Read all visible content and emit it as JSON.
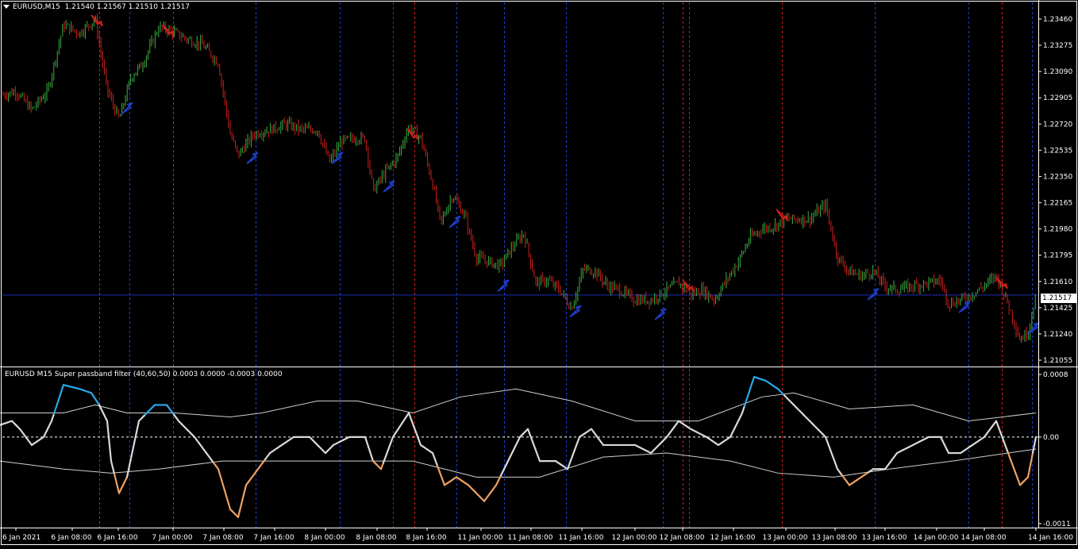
{
  "header": {
    "symbol": "EURUSD,M15",
    "ohlc": "1.21540 1.21567 1.21510 1.21517"
  },
  "indicator": {
    "title": "EURUSD M15 Super passband filter (40,60,50) 0.0003 0.0000 -0.0003 0.0000"
  },
  "current_price": "1.21517",
  "colors": {
    "background": "#000000",
    "bull_candle": "#3cb043",
    "bear_candle": "#d0211c",
    "red_vline": "#d0211c",
    "blue_vline": "#1f3fd0",
    "up_arrow": "#1f3fd0",
    "down_arrow": "#d0211c",
    "filter_up": "#2aa8e8",
    "filter_down": "#f0a060",
    "filter_neutral": "#d8d8d8",
    "band": "#cfcfcf",
    "price_line": "#1f2fb0"
  },
  "chart_data": [
    {
      "type": "candlestick",
      "title": "EURUSD,M15",
      "y_ticks": [
        "1.23460",
        "1.23275",
        "1.23090",
        "1.22905",
        "1.22720",
        "1.22535",
        "1.22350",
        "1.22165",
        "1.21980",
        "1.21795",
        "1.21610",
        "1.21425",
        "1.21240",
        "1.21055"
      ],
      "ylim": [
        1.21055,
        1.2346
      ],
      "x_ticks": [
        "6 Jan 2021",
        "6 Jan 08:00",
        "6 Jan 16:00",
        "7 Jan 00:00",
        "7 Jan 08:00",
        "7 Jan 16:00",
        "8 Jan 00:00",
        "8 Jan 08:00",
        "8 Jan 16:00",
        "11 Jan 00:00",
        "11 Jan 08:00",
        "11 Jan 16:00",
        "12 Jan 00:00",
        "12 Jan 08:00",
        "12 Jan 16:00",
        "13 Jan 00:00",
        "13 Jan 08:00",
        "13 Jan 16:00",
        "14 Jan 00:00",
        "14 Jan 08:00",
        "14 Jan 16:00"
      ],
      "price_path": [
        [
          0,
          1.2292
        ],
        [
          20,
          1.2295
        ],
        [
          40,
          1.2282
        ],
        [
          60,
          1.2295
        ],
        [
          80,
          1.2342
        ],
        [
          100,
          1.2336
        ],
        [
          120,
          1.2346
        ],
        [
          135,
          1.2296
        ],
        [
          150,
          1.2275
        ],
        [
          165,
          1.2305
        ],
        [
          180,
          1.2315
        ],
        [
          200,
          1.234
        ],
        [
          215,
          1.2338
        ],
        [
          235,
          1.2332
        ],
        [
          255,
          1.2328
        ],
        [
          275,
          1.2315
        ],
        [
          290,
          1.2265
        ],
        [
          300,
          1.225
        ],
        [
          320,
          1.2265
        ],
        [
          340,
          1.2268
        ],
        [
          360,
          1.2272
        ],
        [
          380,
          1.2268
        ],
        [
          400,
          1.2268
        ],
        [
          415,
          1.2245
        ],
        [
          430,
          1.226
        ],
        [
          450,
          1.2262
        ],
        [
          460,
          1.2262
        ],
        [
          470,
          1.2225
        ],
        [
          485,
          1.2238
        ],
        [
          500,
          1.2248
        ],
        [
          515,
          1.227
        ],
        [
          530,
          1.2262
        ],
        [
          545,
          1.223
        ],
        [
          555,
          1.2202
        ],
        [
          570,
          1.2222
        ],
        [
          585,
          1.2208
        ],
        [
          600,
          1.2178
        ],
        [
          615,
          1.2175
        ],
        [
          630,
          1.2172
        ],
        [
          645,
          1.2185
        ],
        [
          660,
          1.2195
        ],
        [
          675,
          1.216
        ],
        [
          690,
          1.2162
        ],
        [
          705,
          1.2155
        ],
        [
          720,
          1.2142
        ],
        [
          735,
          1.217
        ],
        [
          750,
          1.2168
        ],
        [
          765,
          1.2158
        ],
        [
          780,
          1.2155
        ],
        [
          800,
          1.2148
        ],
        [
          820,
          1.2148
        ],
        [
          840,
          1.2155
        ],
        [
          855,
          1.216
        ],
        [
          870,
          1.2152
        ],
        [
          885,
          1.2155
        ],
        [
          900,
          1.2148
        ],
        [
          915,
          1.2162
        ],
        [
          930,
          1.2175
        ],
        [
          945,
          1.2192
        ],
        [
          960,
          1.2198
        ],
        [
          975,
          1.22
        ],
        [
          990,
          1.2205
        ],
        [
          1005,
          1.2205
        ],
        [
          1020,
          1.2205
        ],
        [
          1040,
          1.2215
        ],
        [
          1055,
          1.2178
        ],
        [
          1070,
          1.2168
        ],
        [
          1085,
          1.2165
        ],
        [
          1100,
          1.2168
        ],
        [
          1115,
          1.2158
        ],
        [
          1130,
          1.2155
        ],
        [
          1150,
          1.2158
        ],
        [
          1170,
          1.216
        ],
        [
          1185,
          1.2162
        ],
        [
          1195,
          1.2145
        ],
        [
          1210,
          1.2148
        ],
        [
          1225,
          1.2152
        ],
        [
          1240,
          1.2158
        ],
        [
          1255,
          1.2165
        ],
        [
          1270,
          1.2145
        ],
        [
          1285,
          1.212
        ],
        [
          1295,
          1.2125
        ],
        [
          1305,
          1.2152
        ]
      ],
      "down_arrows": [
        {
          "x": 122,
          "y": 1.2345
        },
        {
          "x": 212,
          "y": 1.2338
        },
        {
          "x": 520,
          "y": 1.2265
        },
        {
          "x": 867,
          "y": 1.2158
        },
        {
          "x": 985,
          "y": 1.2208
        },
        {
          "x": 1262,
          "y": 1.216
        }
      ],
      "up_arrows": [
        {
          "x": 160,
          "y": 1.2283
        },
        {
          "x": 318,
          "y": 1.2248
        },
        {
          "x": 425,
          "y": 1.2248
        },
        {
          "x": 490,
          "y": 1.2228
        },
        {
          "x": 573,
          "y": 1.2203
        },
        {
          "x": 634,
          "y": 1.2158
        },
        {
          "x": 725,
          "y": 1.214
        },
        {
          "x": 832,
          "y": 1.2138
        },
        {
          "x": 1100,
          "y": 1.2152
        },
        {
          "x": 1215,
          "y": 1.2143
        },
        {
          "x": 1302,
          "y": 1.2128
        }
      ]
    },
    {
      "type": "line",
      "title": "EURUSD M15 Super passband filter (40,60,50) 0.0003 0.0000 -0.0003 0.0000",
      "y_ticks": [
        "0.0008",
        "0.00",
        "-0.0011"
      ],
      "ylim": [
        -0.0011,
        0.0008
      ],
      "series": [
        {
          "values": [
            [
              0,
              0.00015
            ],
            [
              15,
              0.0002
            ],
            [
              25,
              0.0001
            ],
            [
              40,
              -0.0001
            ],
            [
              55,
              0.0
            ],
            [
              65,
              0.0002
            ],
            [
              80,
              0.00065
            ],
            [
              100,
              0.0006
            ],
            [
              115,
              0.00055
            ],
            [
              125,
              0.0004
            ],
            [
              135,
              0.0002
            ],
            [
              140,
              -0.0003
            ],
            [
              150,
              -0.0007
            ],
            [
              160,
              -0.0005
            ],
            [
              175,
              0.0002
            ],
            [
              195,
              0.0004
            ],
            [
              210,
              0.0004
            ],
            [
              225,
              0.0002
            ],
            [
              245,
              0.0
            ],
            [
              260,
              -0.0002
            ],
            [
              275,
              -0.0004
            ],
            [
              290,
              -0.0009
            ],
            [
              300,
              -0.001
            ],
            [
              310,
              -0.0006
            ],
            [
              325,
              -0.0004
            ],
            [
              340,
              -0.0002
            ],
            [
              355,
              -0.0001
            ],
            [
              370,
              0.0
            ],
            [
              390,
              0.0
            ],
            [
              410,
              -0.0002
            ],
            [
              420,
              -0.0001
            ],
            [
              440,
              0.0
            ],
            [
              460,
              0.0
            ],
            [
              470,
              -0.0003
            ],
            [
              480,
              -0.0004
            ],
            [
              495,
              0.0
            ],
            [
              515,
              0.0003
            ],
            [
              530,
              -0.0001
            ],
            [
              545,
              -0.0002
            ],
            [
              560,
              -0.0006
            ],
            [
              575,
              -0.0005
            ],
            [
              590,
              -0.0006
            ],
            [
              610,
              -0.0008
            ],
            [
              625,
              -0.0006
            ],
            [
              640,
              -0.0003
            ],
            [
              655,
              0.0
            ],
            [
              665,
              0.0001
            ],
            [
              680,
              -0.0003
            ],
            [
              700,
              -0.0003
            ],
            [
              715,
              -0.0004
            ],
            [
              730,
              0.0
            ],
            [
              745,
              0.0001
            ],
            [
              760,
              -0.0001
            ],
            [
              780,
              -0.0001
            ],
            [
              800,
              -0.0001
            ],
            [
              820,
              -0.0002
            ],
            [
              840,
              0.0
            ],
            [
              855,
              0.0002
            ],
            [
              870,
              0.0001
            ],
            [
              890,
              0.0
            ],
            [
              905,
              -0.0001
            ],
            [
              920,
              0.0
            ],
            [
              935,
              0.0003
            ],
            [
              950,
              0.00075
            ],
            [
              965,
              0.0007
            ],
            [
              980,
              0.0006
            ],
            [
              1000,
              0.0004
            ],
            [
              1020,
              0.0002
            ],
            [
              1040,
              0.0
            ],
            [
              1055,
              -0.0004
            ],
            [
              1070,
              -0.0006
            ],
            [
              1085,
              -0.0005
            ],
            [
              1100,
              -0.0004
            ],
            [
              1115,
              -0.0004
            ],
            [
              1130,
              -0.0002
            ],
            [
              1150,
              -0.0001
            ],
            [
              1170,
              0.0
            ],
            [
              1185,
              0.0
            ],
            [
              1195,
              -0.0002
            ],
            [
              1210,
              -0.0002
            ],
            [
              1225,
              -0.0001
            ],
            [
              1240,
              0.0
            ],
            [
              1255,
              0.0002
            ],
            [
              1270,
              -0.0002
            ],
            [
              1285,
              -0.0006
            ],
            [
              1295,
              -0.0005
            ],
            [
              1305,
              0.0
            ]
          ]
        },
        {
          "values": [
            [
              0,
              0.0003
            ],
            [
              80,
              0.0003
            ],
            [
              120,
              0.0004
            ],
            [
              160,
              0.0003
            ],
            [
              220,
              0.0003
            ],
            [
              290,
              0.00025
            ],
            [
              330,
              0.0003
            ],
            [
              400,
              0.00045
            ],
            [
              450,
              0.00045
            ],
            [
              520,
              0.0003
            ],
            [
              580,
              0.0005
            ],
            [
              650,
              0.0006
            ],
            [
              720,
              0.00045
            ],
            [
              800,
              0.0002
            ],
            [
              880,
              0.0002
            ],
            [
              960,
              0.0005
            ],
            [
              1000,
              0.00055
            ],
            [
              1070,
              0.00035
            ],
            [
              1150,
              0.0004
            ],
            [
              1220,
              0.0002
            ],
            [
              1305,
              0.0003
            ]
          ]
        },
        {
          "values": [
            [
              0,
              -0.0003
            ],
            [
              80,
              -0.0004
            ],
            [
              140,
              -0.00045
            ],
            [
              200,
              -0.0004
            ],
            [
              280,
              -0.0003
            ],
            [
              360,
              -0.0003
            ],
            [
              430,
              -0.0003
            ],
            [
              520,
              -0.0003
            ],
            [
              600,
              -0.0005
            ],
            [
              680,
              -0.0005
            ],
            [
              760,
              -0.00025
            ],
            [
              840,
              -0.0002
            ],
            [
              920,
              -0.0003
            ],
            [
              980,
              -0.00045
            ],
            [
              1050,
              -0.0005
            ],
            [
              1120,
              -0.0004
            ],
            [
              1200,
              -0.0003
            ],
            [
              1305,
              -0.00015
            ]
          ]
        }
      ]
    }
  ],
  "vlines": {
    "red": [
      125,
      218,
      522,
      860,
      868,
      985,
      1262
    ],
    "blue": [
      163,
      322,
      428,
      495,
      575,
      635,
      713,
      835,
      1102,
      1220,
      1300
    ]
  }
}
